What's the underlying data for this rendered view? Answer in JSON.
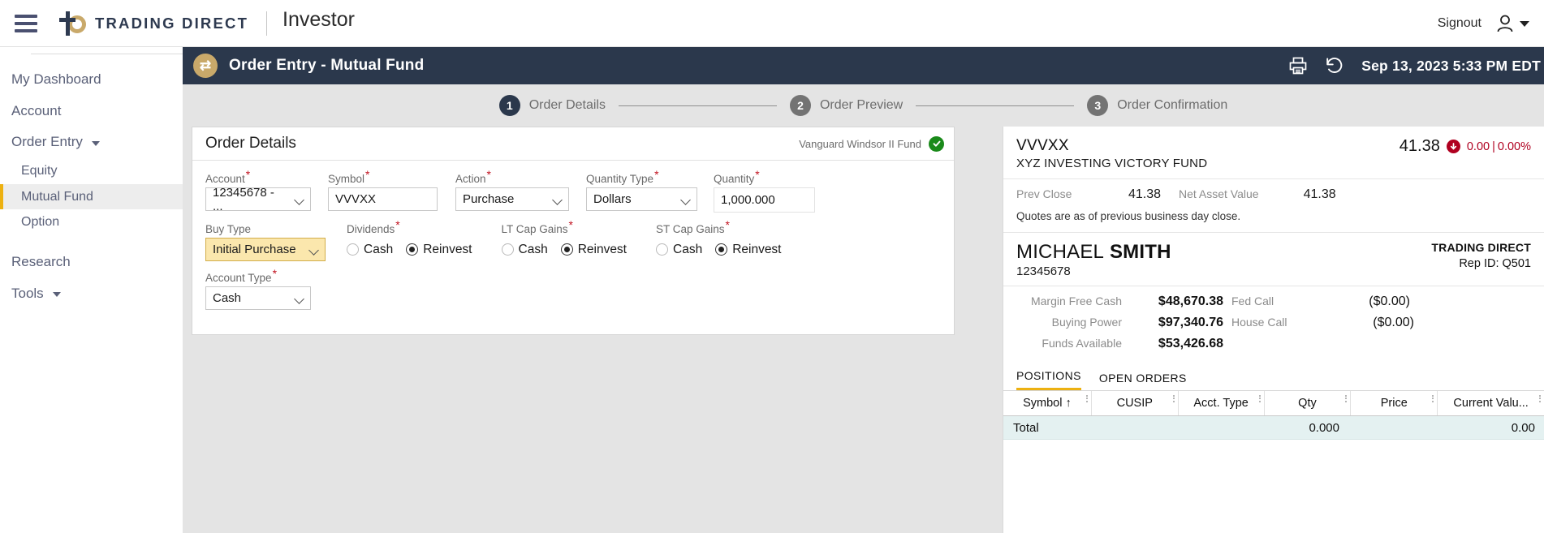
{
  "topbar": {
    "brand": "TRADING DIRECT",
    "app_title": "Investor",
    "signout": "Signout",
    "menu_icon": "hamburger-icon",
    "user_icon": "user-avatar-icon"
  },
  "sidebar": {
    "items": [
      {
        "label": "My Dashboard",
        "level": "top",
        "active": false,
        "caret": false
      },
      {
        "label": "Account",
        "level": "top",
        "active": false,
        "caret": false
      },
      {
        "label": "Order Entry",
        "level": "top",
        "active": false,
        "caret": true
      },
      {
        "label": "Equity",
        "level": "sub",
        "active": false,
        "caret": false
      },
      {
        "label": "Mutual Fund",
        "level": "sub",
        "active": true,
        "caret": false
      },
      {
        "label": "Option",
        "level": "sub",
        "active": false,
        "caret": false
      },
      {
        "label": "Research",
        "level": "top",
        "active": false,
        "caret": false
      },
      {
        "label": "Tools",
        "level": "top",
        "active": false,
        "caret": true
      }
    ]
  },
  "page_header": {
    "badge_icon": "exchange-arrows-icon",
    "title": "Order Entry - Mutual Fund",
    "print_icon": "printer-icon",
    "refresh_icon": "history-refresh-icon",
    "timestamp": "Sep 13, 2023 5:33 PM EDT"
  },
  "stepper": {
    "steps": [
      {
        "num": "1",
        "label": "Order Details",
        "state": "active"
      },
      {
        "num": "2",
        "label": "Order Preview",
        "state": "inactive"
      },
      {
        "num": "3",
        "label": "Order Confirmation",
        "state": "inactive"
      }
    ]
  },
  "order_details": {
    "heading": "Order Details",
    "fund_name": "Vanguard Windsor II Fund",
    "validated_icon": "green-check-icon",
    "fields": {
      "account": {
        "label": "Account",
        "required": true,
        "value": "12345678  - ..."
      },
      "symbol": {
        "label": "Symbol",
        "required": true,
        "value": "VVVXX"
      },
      "action": {
        "label": "Action",
        "required": true,
        "value": "Purchase"
      },
      "quantity_type": {
        "label": "Quantity Type",
        "required": true,
        "value": "Dollars"
      },
      "quantity": {
        "label": "Quantity",
        "required": true,
        "value": "1,000.000"
      },
      "buy_type": {
        "label": "Buy Type",
        "required": false,
        "value": "Initial Purchase"
      },
      "account_type": {
        "label": "Account Type",
        "required": true,
        "value": "Cash"
      }
    },
    "radio_groups": [
      {
        "label": "Dividends",
        "required": true,
        "options": [
          "Cash",
          "Reinvest"
        ],
        "selected": "Reinvest"
      },
      {
        "label": "LT Cap Gains",
        "required": true,
        "options": [
          "Cash",
          "Reinvest"
        ],
        "selected": "Reinvest"
      },
      {
        "label": "ST Cap Gains",
        "required": true,
        "options": [
          "Cash",
          "Reinvest"
        ],
        "selected": "Reinvest"
      }
    ]
  },
  "quote": {
    "symbol": "VVVXX",
    "name": "XYZ INVESTING VICTORY FUND",
    "price": "41.38",
    "change": "0.00",
    "change_pct": "0.00%",
    "change_direction_icon": "down-arrow-circle-icon",
    "change_color": "#b00020",
    "prev_close_label": "Prev Close",
    "prev_close_value": "41.38",
    "nav_label": "Net Asset Value",
    "nav_value": "41.38",
    "note": "Quotes are as of previous business day close."
  },
  "account_panel": {
    "first_name": "MICHAEL",
    "last_name": "SMITH",
    "account_number": "12345678",
    "firm": "TRADING DIRECT",
    "rep_id": "Rep ID: Q501",
    "balances": [
      {
        "label": "Margin Free Cash",
        "value": "$48,670.38"
      },
      {
        "label": "Buying Power",
        "value": "$97,340.76"
      },
      {
        "label": "Funds Available",
        "value": "$53,426.68"
      }
    ],
    "calls": [
      {
        "label": "Fed Call",
        "value": "($0.00)"
      },
      {
        "label": "House Call",
        "value": "($0.00)"
      }
    ],
    "tabs": [
      {
        "label": "POSITIONS",
        "active": true
      },
      {
        "label": "OPEN ORDERS",
        "active": false
      }
    ],
    "grid": {
      "columns": [
        "Symbol ↑",
        "CUSIP",
        "Acct. Type",
        "Qty",
        "Price",
        "Current Valu..."
      ],
      "total_row": {
        "label": "Total",
        "qty": "0.000",
        "value": "0.00"
      }
    }
  }
}
